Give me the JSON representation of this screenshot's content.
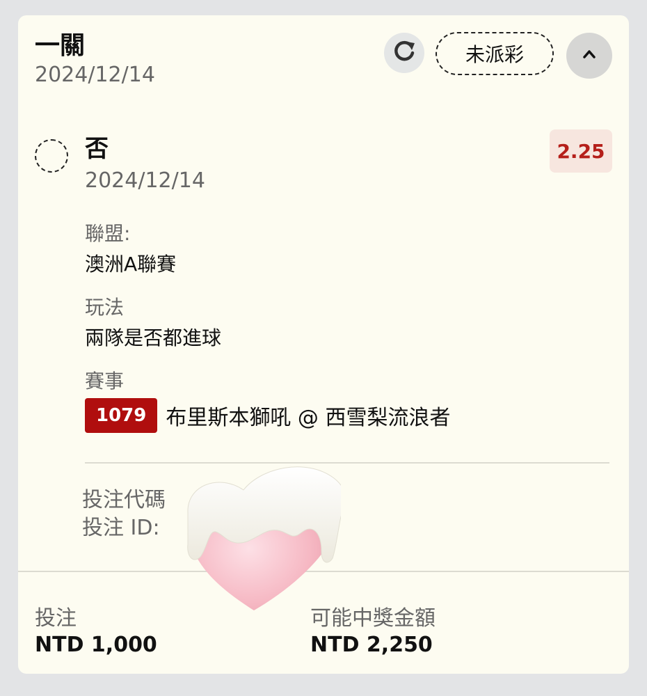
{
  "header": {
    "bet_type": "一關",
    "date": "2024/12/14",
    "status": "未派彩"
  },
  "selection": {
    "name": "否",
    "date": "2024/12/14",
    "odds": "2.25",
    "league_label": "聯盟:",
    "league_value": "澳洲A聯賽",
    "market_label": "玩法",
    "market_value": "兩隊是否都進球",
    "event_label": "賽事",
    "event_id": "1079",
    "event_teams": "布里斯本獅吼 @ 西雪梨流浪者"
  },
  "codes": {
    "bet_code_label": "投注代碼",
    "bet_id_label": "投注 ID:"
  },
  "footer": {
    "stake_label": "投注",
    "stake_value": "NTD 1,000",
    "payout_label": "可能中獎金額",
    "payout_value": "NTD 2,250"
  },
  "colors": {
    "odds_text": "#b51f1a",
    "odds_bg": "#f7e6df",
    "event_badge": "#b00e0e",
    "card_bg": "#fdfcf1"
  },
  "icons": {
    "refresh": "refresh-icon",
    "collapse": "chevron-up-icon",
    "sticker": "heart-sticker-icon"
  }
}
